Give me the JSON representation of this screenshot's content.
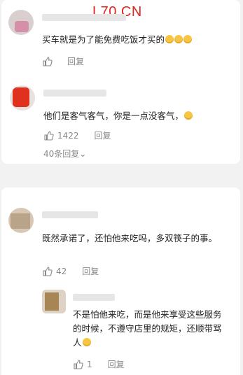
{
  "watermark": "L70.CN",
  "comments": [
    {
      "text": "买车就是为了能免费吃饭才买的",
      "emoji_count": 3,
      "like_count": "",
      "reply_label": "回复"
    },
    {
      "text": "他们是客气客气，你是一点没客气，",
      "emoji_count": 1,
      "like_count": "1422",
      "reply_label": "回复",
      "more_replies": "40条回复⌄"
    },
    {
      "text": "既然承诺了，还怕他来吃吗，多双筷子的事。",
      "emoji_count": 0,
      "like_count": "42",
      "reply_label": "回复"
    },
    {
      "text": "不是怕他来吃，而是他来享受这些服务的时候，不遵守店里的规矩，还顺带骂人",
      "emoji_count": 1,
      "like_count": "1",
      "reply_label": "回复"
    }
  ],
  "colors": {
    "watermark": "#e0261f",
    "background": "#f2f2f2",
    "card": "#ffffff",
    "muted_text": "#888888"
  },
  "icons": {
    "like": "thumbs-up-icon",
    "emoji": "laugh-emoji-icon"
  }
}
